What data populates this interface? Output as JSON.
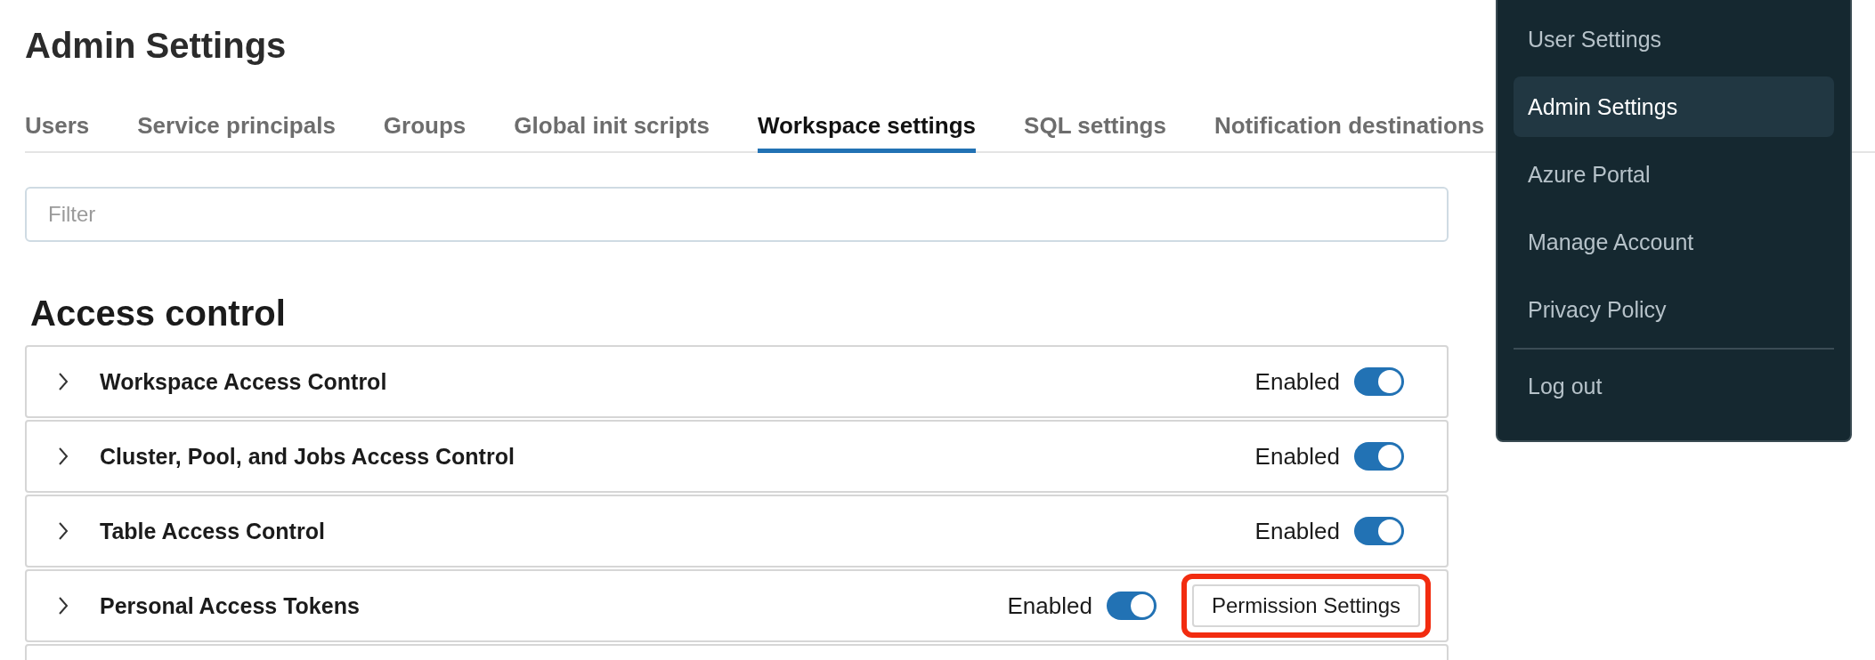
{
  "page": {
    "title": "Admin Settings"
  },
  "tabs": [
    {
      "label": "Users",
      "selected": false
    },
    {
      "label": "Service principals",
      "selected": false
    },
    {
      "label": "Groups",
      "selected": false
    },
    {
      "label": "Global init scripts",
      "selected": false
    },
    {
      "label": "Workspace settings",
      "selected": true
    },
    {
      "label": "SQL settings",
      "selected": false
    },
    {
      "label": "Notification destinations",
      "selected": false
    }
  ],
  "filter": {
    "placeholder": "Filter"
  },
  "section": {
    "heading": "Access control",
    "rows": [
      {
        "label": "Workspace Access Control",
        "status": "Enabled",
        "on": true,
        "expanded": false
      },
      {
        "label": "Cluster, Pool, and Jobs Access Control",
        "status": "Enabled",
        "on": true,
        "expanded": false
      },
      {
        "label": "Table Access Control",
        "status": "Enabled",
        "on": true,
        "expanded": false
      },
      {
        "label": "Personal Access Tokens",
        "status": "Enabled",
        "on": true,
        "expanded": false,
        "button": "Permission Settings",
        "highlighted": true
      }
    ]
  },
  "user_menu": {
    "items": [
      {
        "label": "User Settings",
        "selected": false
      },
      {
        "label": "Admin Settings",
        "selected": true
      },
      {
        "label": "Azure Portal",
        "selected": false
      },
      {
        "label": "Manage Account",
        "selected": false
      },
      {
        "label": "Privacy Policy",
        "selected": false
      },
      {
        "label": "Log out",
        "selected": false,
        "divider_before": true
      }
    ]
  }
}
